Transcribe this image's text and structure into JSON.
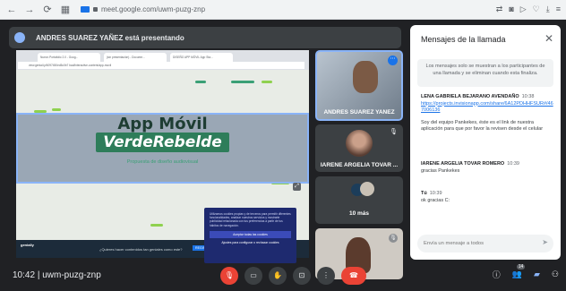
{
  "browser": {
    "url": "meet.google.com/uwm-puzg-znp"
  },
  "presenter_banner": "ANDRES SUAREZ YAÑEZ está presentando",
  "shared_screen": {
    "tabs": [
      "Nuevo Portafolio 2.0 - Goog...",
      "(sin presentación) - Docume...",
      "DISEÑO APP MÓVIL App Sta..."
    ],
    "address": "view.genial.ly/6097450ed5c0b7 bad/interactive-content/app-movil",
    "slide_title": "App Móvil",
    "slide_logo": "VerdeRebelde",
    "slide_subtitle": "Propuesta de diseño audiovisual",
    "footer_brand": "genially",
    "footer_question": "¿Quieres hacer contenidos tan geniales como este?",
    "footer_cta": "REGISTRATE",
    "cookie_text": "Utilizamos cookies propias y de terceros para permitir diferentes funcionalidades, analizar nuestros servicios y mostrarte publicidad relacionada con tus preferencias a partir de tus hábitos de navegación.",
    "cookie_accept": "Aceptar todas las cookies",
    "cookie_settings": "Ajustes para configurar o rechazar cookies"
  },
  "tiles": [
    {
      "name": "ANDRES SUAREZ YAÑEZ"
    },
    {
      "name": "IARENE ARGELIA TOVAR ..."
    },
    {
      "name": "10 más"
    },
    {
      "name": ""
    }
  ],
  "chat": {
    "title": "Mensajes de la llamada",
    "notice": "Los mensajes solo se muestran a los participantes de una llamada y se eliminan cuando esta finaliza.",
    "messages": [
      {
        "sender": "LENA GABRIELA BEJARANO AVENDAÑO",
        "time": "10:38",
        "link": "https://projects.invisionapp.com/share/6A12PDHHFSUR#/467006136",
        "text": "Soy del equipo Pankekes, éste es el link de nuestra aplicación para que por favor la revisen desde el celular"
      },
      {
        "sender": "IARENE ARGELIA TOVAR ROMERO",
        "time": "10:39",
        "text": "gracias Pankekes"
      },
      {
        "sender": "Tú",
        "time": "10:39",
        "text": "ok gracias C:"
      }
    ],
    "compose_placeholder": "Envía un mensaje a todos"
  },
  "bottom_bar": {
    "time": "10:42",
    "meeting_code": "uwm-puzg-znp",
    "participants_count": "14"
  }
}
